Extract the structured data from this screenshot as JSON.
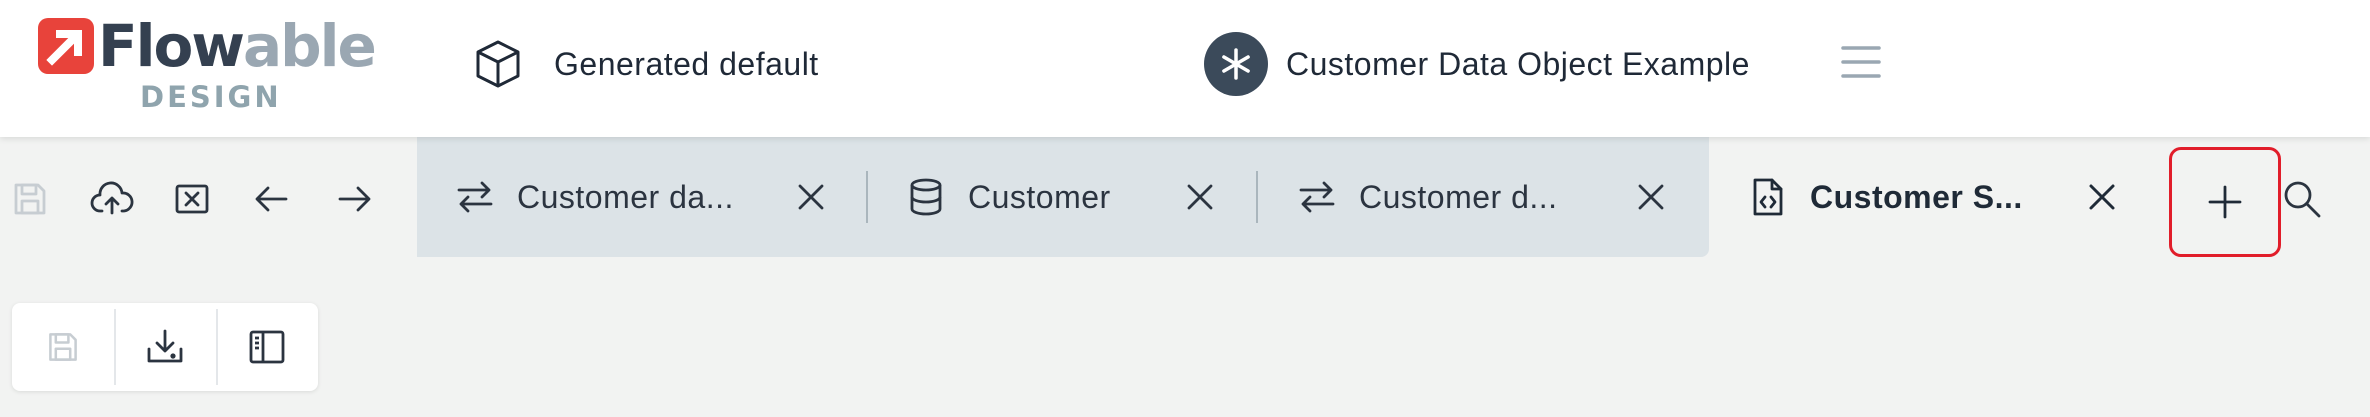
{
  "brand": {
    "name_part1": "Flow",
    "name_part2": "able",
    "subtitle": "DESIGN",
    "primary_color": "#e8433b",
    "dark_color": "#344050",
    "light_color": "#9aa7b2"
  },
  "header": {
    "app_name": "Generated default",
    "app_icon": "cube-icon",
    "model_name": "Customer Data Object Example",
    "model_icon": "asterisk-icon",
    "menu_icon": "hamburger-menu-icon"
  },
  "toolbar": {
    "icons": [
      "save-icon",
      "upload-cloud-icon",
      "close-box-icon",
      "arrow-left-icon",
      "arrow-right-icon"
    ]
  },
  "tabs": [
    {
      "label": "Customer da...",
      "icon": "swap-arrows-icon",
      "active": false
    },
    {
      "label": "Customer",
      "icon": "database-icon",
      "active": false
    },
    {
      "label": "Customer d...",
      "icon": "swap-arrows-icon",
      "active": false
    },
    {
      "label": "Customer S...",
      "icon": "code-file-icon",
      "active": true
    }
  ],
  "tab_actions": {
    "add_icon": "plus-icon",
    "search_icon": "search-icon",
    "highlight_color": "#e11d2a"
  },
  "subtoolbar": {
    "icons": [
      "save-icon",
      "download-icon",
      "side-panel-icon"
    ]
  }
}
